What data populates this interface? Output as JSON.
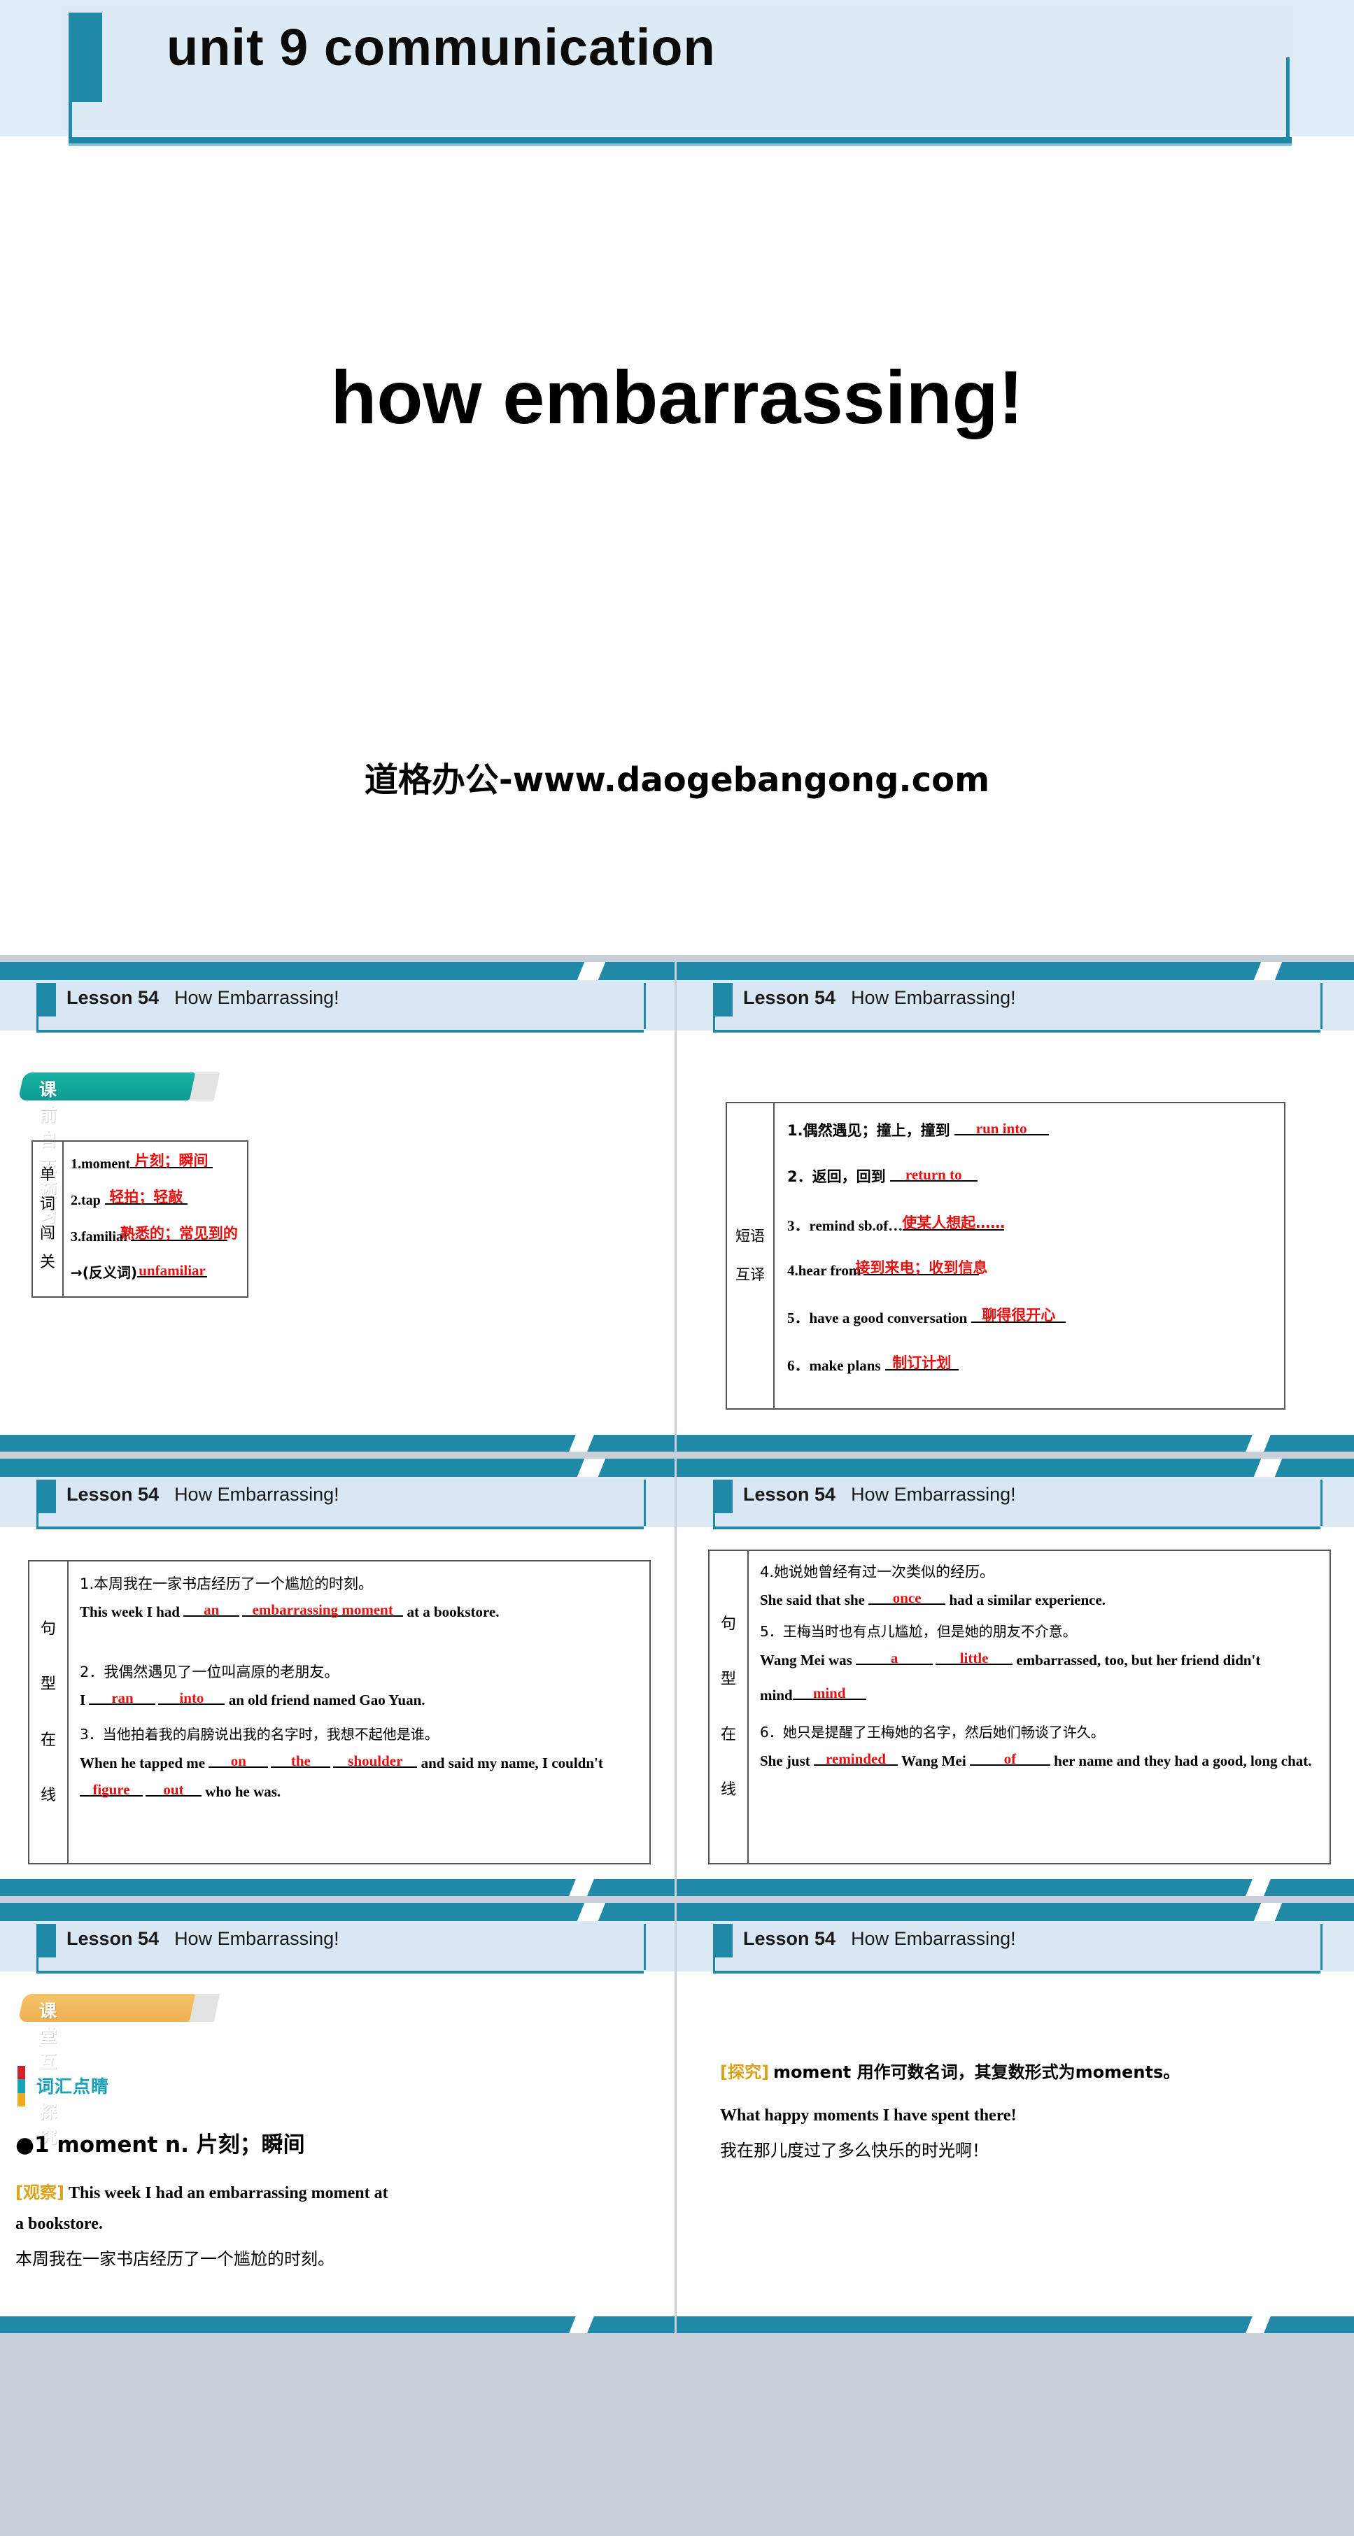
{
  "title_slide": {
    "header_title": "unit 9   communication",
    "main_title": "how embarrassing!",
    "watermark": "道格办公-www.daogebangong.com"
  },
  "slide_header": {
    "lesson": "Lesson 54",
    "topic": "How Embarrassing!"
  },
  "slides": [
    {
      "id": "slide-vocab-preview",
      "tag": {
        "text": "课前自主预习",
        "color": "#12a99c"
      },
      "table": {
        "label": [
          "单",
          "词",
          "闯",
          "关"
        ],
        "rows": [
          {
            "num": "1.",
            "word": "moment",
            "answer": "片刻；瞬间"
          },
          {
            "num": "2.",
            "word": "tap",
            "answer": "轻拍；轻敲"
          },
          {
            "num": "3.",
            "word": "familiar",
            "answer": "熟悉的；常见到的"
          },
          {
            "num": "",
            "word": "→(反义词)",
            "answer": "unfamiliar"
          }
        ]
      }
    },
    {
      "id": "slide-phrase-translate",
      "table": {
        "label": [
          "短语",
          "互译"
        ],
        "rows": [
          {
            "num": "1.",
            "prompt": "偶然遇见；撞上，撞到",
            "answer": "run into"
          },
          {
            "num": "2．",
            "prompt": "返回，回到",
            "answer": "return to"
          },
          {
            "num": "3．",
            "prompt": "remind sb.of…",
            "answer": "使某人想起……"
          },
          {
            "num": "4.",
            "prompt": "hear from",
            "answer": "接到来电；收到信息"
          },
          {
            "num": "5．",
            "prompt": "have a good conversation",
            "answer": "聊得很开心"
          },
          {
            "num": "6．",
            "prompt": "make plans",
            "answer": "制订计划"
          }
        ]
      }
    },
    {
      "id": "slide-sentences-1",
      "table": {
        "label": [
          "句",
          "型",
          "在",
          "线"
        ],
        "items": [
          {
            "cn": "1.本周我在一家书店经历了一个尴尬的时刻。",
            "en_parts": [
              "This week I had ",
              "an",
              " ",
              "embarrassing  moment",
              " at a bookstore."
            ],
            "blanks": [
              "an",
              "embarrassing  moment"
            ]
          },
          {
            "cn": "2．我偶然遇见了一位叫高原的老朋友。",
            "en_parts": [
              "I ",
              "ran",
              " ",
              "into",
              " an old friend named Gao Yuan."
            ],
            "blanks": [
              "ran",
              "into"
            ]
          },
          {
            "cn": "3．当他拍着我的肩膀说出我的名字时，我想不起他是谁。",
            "en_parts": [
              "When he tapped me ",
              "on",
              " ",
              "the",
              " ",
              "shoulder",
              " and said my name, I couldn't ",
              "figure",
              " ",
              "out",
              " who he was."
            ],
            "blanks": [
              "on",
              "the",
              "shoulder",
              "figure",
              "out"
            ]
          }
        ]
      }
    },
    {
      "id": "slide-sentences-2",
      "table": {
        "label": [
          "句",
          "型",
          "在",
          "线"
        ],
        "items": [
          {
            "cn": "4.她说她曾经有过一次类似的经历。",
            "en_parts": [
              "She said that she ",
              "once",
              " had a similar experience."
            ],
            "blanks": [
              "once"
            ]
          },
          {
            "cn": "5．王梅当时也有点儿尴尬，但是她的朋友不介意。",
            "en_parts": [
              "Wang Mei was ",
              "a",
              " ",
              "little",
              " embarrassed, too, but her friend didn't ",
              "mind",
              "."
            ],
            "blanks": [
              "a",
              "little",
              "mind"
            ]
          },
          {
            "cn": "6．她只是提醒了王梅她的名字，然后她们畅谈了许久。",
            "en_parts": [
              "She just ",
              "reminded",
              " Wang Mei ",
              "of",
              " her name and they had a good, long chat."
            ],
            "blanks": [
              "reminded",
              "of"
            ]
          }
        ]
      }
    },
    {
      "id": "slide-interactive-explore",
      "tag": {
        "text": "课堂互动探究",
        "color": "#f0b košík"
      },
      "section_title": "词汇点睛",
      "entry": "●1  moment n. 片刻；瞬间",
      "observe_label": "[观察]",
      "observe_en": "This week I had an embarrassing moment at",
      "observe_en2": "a bookstore.",
      "observe_cn": "本周我在一家书店经历了一个尴尬的时刻。"
    },
    {
      "id": "slide-explore-note",
      "explore_label": "[探究]",
      "explore_cn": "moment 用作可数名词，其复数形式为moments。",
      "example_en": "What happy moments I have spent there!",
      "example_cn": "我在那儿度过了多么快乐的时光啊！"
    }
  ],
  "colors": {
    "teal": "#2089a8",
    "header_bg": "#dceaf5",
    "answer_red": "#e8100f",
    "tag_green": "#12a99c",
    "tag_orange": "#f0b košík",
    "gold": "#d9a31c"
  }
}
